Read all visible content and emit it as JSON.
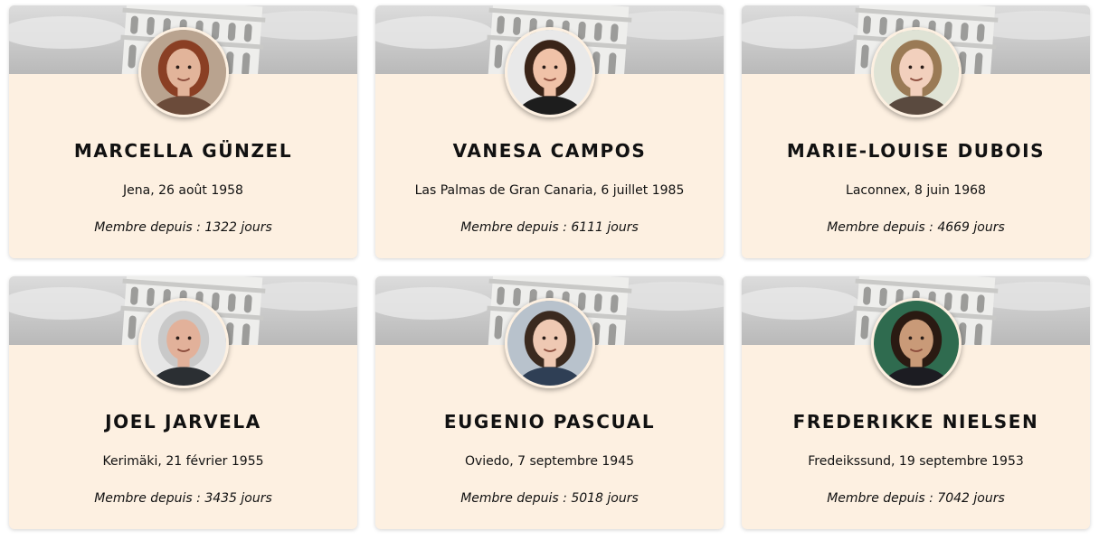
{
  "members": [
    {
      "name": "Marcella Günzel",
      "place_birth": "Jena, 26 août 1958",
      "since": "Membre depuis : 1322 jours",
      "avatar": {
        "bg": "#b9a38f",
        "hair": "#8a3f24",
        "skin": "#e2b49a",
        "shirt": "#6b4b3a"
      }
    },
    {
      "name": "Vanesa Campos",
      "place_birth": "Las Palmas de Gran Canaria, 6 juillet 1985",
      "since": "Membre depuis : 6111 jours",
      "avatar": {
        "bg": "#e9e9e9",
        "hair": "#3a2418",
        "skin": "#f0c2a8",
        "shirt": "#1d1d1d"
      }
    },
    {
      "name": "Marie-Louise Dubois",
      "place_birth": "Laconnex, 8 juin 1968",
      "since": "Membre depuis : 4669 jours",
      "avatar": {
        "bg": "#dfe3d5",
        "hair": "#9a7a55",
        "skin": "#f2d0bd",
        "shirt": "#5a4a3f"
      }
    },
    {
      "name": "Joel Jarvela",
      "place_birth": "Kerimäki, 21 février 1955",
      "since": "Membre depuis : 3435 jours",
      "avatar": {
        "bg": "#e6e6e6",
        "hair": "#c9c9c9",
        "skin": "#e2b19a",
        "shirt": "#2b2f33"
      }
    },
    {
      "name": "Eugenio Pascual",
      "place_birth": "Oviedo, 7 septembre 1945",
      "since": "Membre depuis : 5018 jours",
      "avatar": {
        "bg": "#b8c2cc",
        "hair": "#3b2a1f",
        "skin": "#efc9b3",
        "shirt": "#2f3f55"
      }
    },
    {
      "name": "Frederikke Nielsen",
      "place_birth": "Fredeikssund, 19 septembre 1953",
      "since": "Membre depuis : 7042 jours",
      "avatar": {
        "bg": "#2f6b4f",
        "hair": "#2a1a12",
        "skin": "#c99a78",
        "shirt": "#1c1c22"
      }
    }
  ]
}
